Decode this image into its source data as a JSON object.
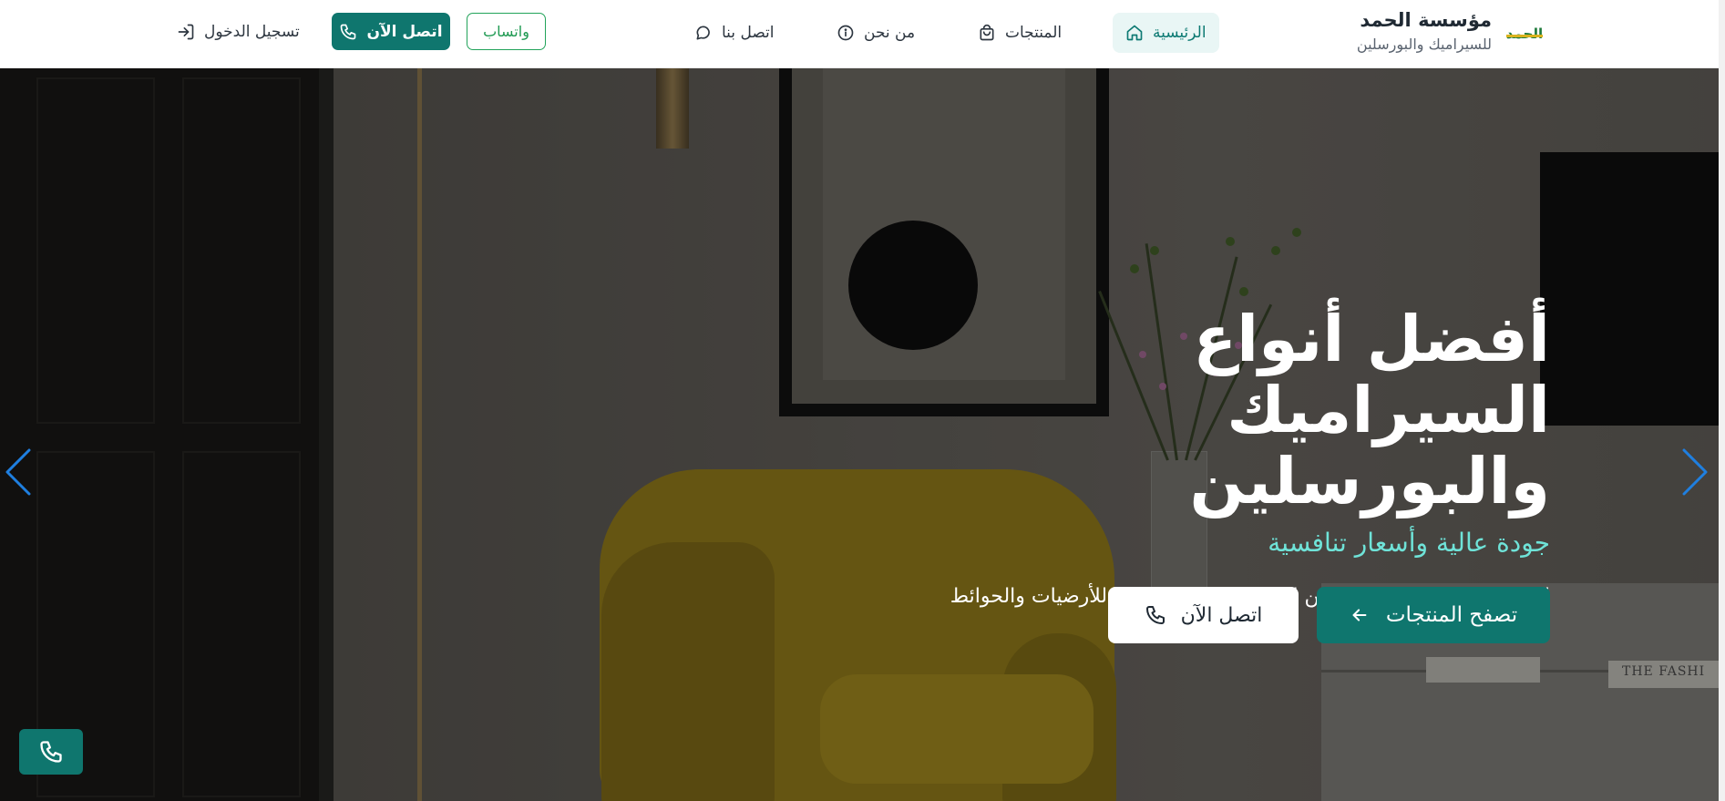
{
  "brand": {
    "logo_text": "الحمد",
    "name": "مؤسسة الحمد",
    "subtitle": "للسيراميك والبورسلين"
  },
  "nav": {
    "home": "الرئيسية",
    "products": "المنتجات",
    "about": "من نحن",
    "contact": "اتصل بنا",
    "whatsapp": "واتساب",
    "call_now": "اتصل الآن",
    "login": "تسجيل الدخول"
  },
  "hero": {
    "title_line1": "أفضل أنواع السيراميك",
    "title_line2": "والبورسلين",
    "subtitle": "جودة عالية وأسعار تنافسية",
    "description": "اكتشف مجموعتنا الواسعة من السيراميك والبورسلين للأرضيات والحوائط",
    "browse_button": "تصفح المنتجات",
    "call_button": "اتصل الآن",
    "image_book_text": "THE FASHI"
  },
  "colors": {
    "primary": "#0f766e",
    "accent_text": "#6fe3d8",
    "whatsapp": "#22a35a",
    "arrow": "#1f7fe0",
    "active_nav_bg": "#e9f6f5"
  },
  "icons": {
    "home": "home-icon",
    "products": "shopping-bag-icon",
    "about": "info-icon",
    "contact": "chat-bubble-icon",
    "call": "phone-icon",
    "login": "login-icon",
    "browse": "arrow-left-icon",
    "prev": "chevron-left-icon",
    "next": "chevron-right-icon"
  }
}
